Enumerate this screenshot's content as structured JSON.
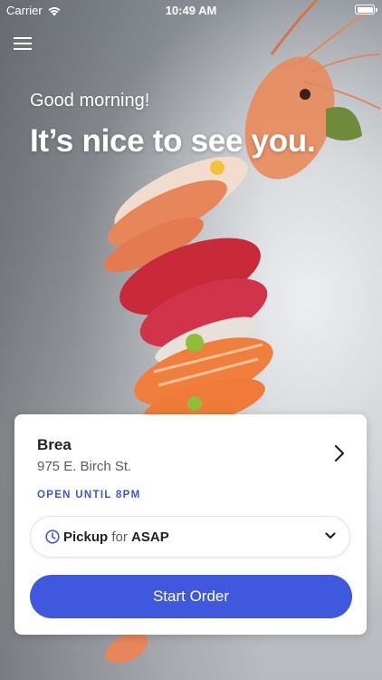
{
  "status_bar": {
    "carrier": "Carrier",
    "time": "10:49 AM"
  },
  "header": {
    "greeting": "Good morning!",
    "headline": "It’s nice to see you."
  },
  "store": {
    "name": "Brea",
    "address": "975 E. Birch St.",
    "status": "OPEN UNTIL 8PM"
  },
  "order": {
    "method": "Pickup",
    "for_label": "for",
    "time": "ASAP",
    "start_button_label": "Start Order"
  },
  "colors": {
    "accent": "#3f58dd",
    "status_text": "#3a56d6",
    "card_background": "#ffffff"
  },
  "icons": {
    "menu": "hamburger-menu-icon",
    "store_chevron": "chevron-right-icon",
    "clock": "clock-icon",
    "dropdown": "chevron-down-icon",
    "wifi": "wifi-icon",
    "battery": "battery-icon"
  }
}
